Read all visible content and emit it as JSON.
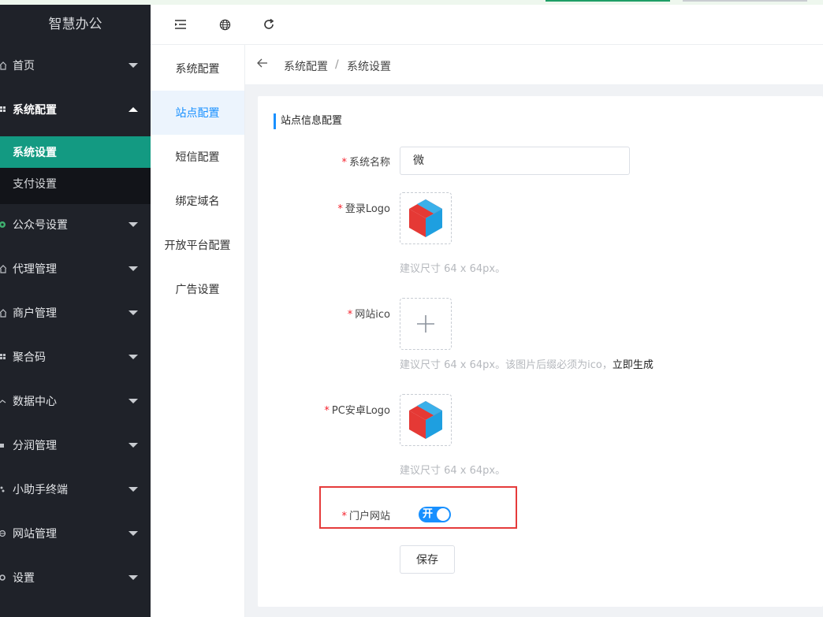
{
  "app": {
    "brand": "智慧办公"
  },
  "sidebar": {
    "items": [
      {
        "label": "首页",
        "icon": "home-icon"
      },
      {
        "label": "系统配置",
        "icon": "grid-icon"
      },
      {
        "label": "公众号设置",
        "icon": "wechat-icon"
      },
      {
        "label": "代理管理",
        "icon": "home-icon"
      },
      {
        "label": "商户管理",
        "icon": "home-icon"
      },
      {
        "label": "聚合码",
        "icon": "grid-icon"
      },
      {
        "label": "数据中心",
        "icon": "chart-icon"
      },
      {
        "label": "分润管理",
        "icon": "square-icon"
      },
      {
        "label": "小助手终端",
        "icon": "robot-icon"
      },
      {
        "label": "网站管理",
        "icon": "globe-icon"
      },
      {
        "label": "设置",
        "icon": "gear-icon"
      }
    ],
    "submenu": [
      {
        "label": "系统设置",
        "active": true
      },
      {
        "label": "支付设置"
      }
    ]
  },
  "tabs": [
    {
      "label": "系统配置"
    },
    {
      "label": "站点配置",
      "active": true
    },
    {
      "label": "短信配置"
    },
    {
      "label": "绑定域名"
    },
    {
      "label": "开放平台配置"
    },
    {
      "label": "广告设置"
    }
  ],
  "breadcrumb": {
    "first": "系统配置",
    "sep": "/",
    "second": "系统设置"
  },
  "form": {
    "section_title": "站点信息配置",
    "system_name_label": "系统名称",
    "system_name_value": "微",
    "login_logo_label": "登录Logo",
    "login_logo_hint": "建议尺寸 64 x 64px。",
    "favicon_label": "网站ico",
    "favicon_hint": "建议尺寸 64 x 64px。该图片后缀必须为ico，",
    "favicon_link": "立即生成",
    "pc_logo_label": "PC安卓Logo",
    "pc_logo_hint": "建议尺寸 64 x 64px。",
    "portal_label": "门户网站",
    "portal_switch_text": "开",
    "portal_enabled": true,
    "save_label": "保存"
  },
  "colors": {
    "sidebar_bg": "#1f2229",
    "accent_green": "#139a82",
    "primary_blue": "#1890ff",
    "required_red": "#f5222d",
    "highlight_red": "#e53b3b"
  }
}
